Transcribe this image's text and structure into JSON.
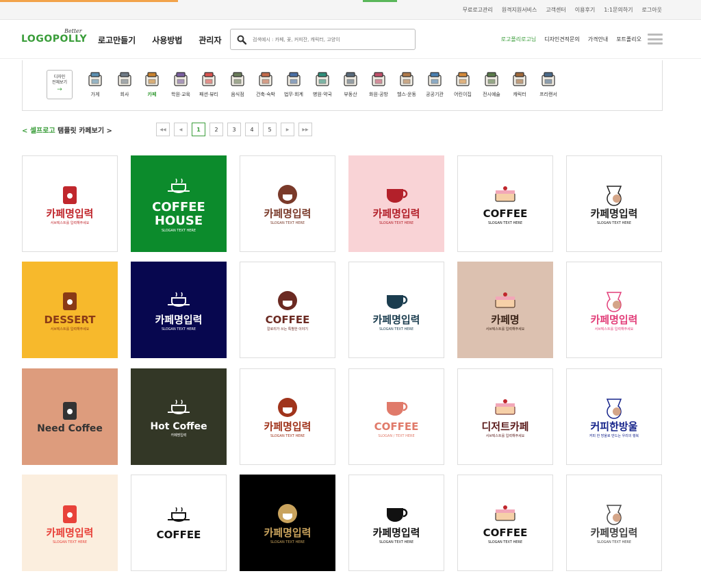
{
  "util_links": [
    "무료로고관리",
    "원격지원서비스",
    "고객센터",
    "이용후기",
    "1:1문의하기",
    "로그아웃"
  ],
  "brand": {
    "better": "Better",
    "name": "LOGOPOLLY",
    "color": "#3a9d3a"
  },
  "main_nav": [
    "로고만들기",
    "사용방법",
    "관리자"
  ],
  "search": {
    "placeholder": "검색예시 : 카페, 꽃, 커피잔, 캐릭터, 고양이"
  },
  "right_nav": [
    "로고폴리로고님",
    "디자인견적문의",
    "가격안내",
    "포트폴리오"
  ],
  "category_all": {
    "line1": "디자인",
    "line2": "전체보기",
    "arrow": "→"
  },
  "categories": [
    "가게",
    "회사",
    "카페",
    "학원·교육",
    "패션·뷰티",
    "음식점",
    "건축·숙박",
    "법무·회계",
    "병원·약국",
    "부동산",
    "화원·공방",
    "헬스·운동",
    "공공기관",
    "어린이집",
    "전시예술",
    "캐릭터",
    "프리랜서"
  ],
  "category_icons": [
    "store-icon",
    "building-icon",
    "coffee-cup-icon",
    "book-icon",
    "tshirt-icon",
    "plate-icon",
    "hotel-icon",
    "document-icon",
    "hospital-icon",
    "truck-icon",
    "easel-icon",
    "muscle-icon",
    "government-icon",
    "child-icon",
    "gallery-icon",
    "teddy-bear-icon",
    "computer-icon"
  ],
  "active_category": "카페",
  "breadcrumb": {
    "prefix": "< 셀프로고",
    "suffix": " 탬플릿 카페보기 >"
  },
  "pagination": {
    "first": "◀◀",
    "prev": "◀",
    "pages": [
      "1",
      "2",
      "3",
      "4",
      "5"
    ],
    "current": "1",
    "next": "▶",
    "last": "▶▶"
  },
  "templates": [
    {
      "title": "카페명입력",
      "sub": "서브텍스트를 입력해주세요",
      "bg": "#ffffff",
      "fg": "#c0272d",
      "icon": "coffee-bag-icon"
    },
    {
      "title": "COFFEE HOUSE",
      "sub": "SLOGAN TEXT HERE",
      "bg": "#0c8b2c",
      "fg": "#ffffff",
      "icon": "cup-steam-icon"
    },
    {
      "title": "카페명입력",
      "sub": "SLOGAN TEXT HERE",
      "bg": "#ffffff",
      "fg": "#7a3a2a",
      "icon": "round-cup-icon"
    },
    {
      "title": "카페명입력",
      "sub": "SLOGAN TEXT HERE",
      "bg": "#f9d3d6",
      "fg": "#b3202a",
      "icon": "teacup-icon"
    },
    {
      "title": "COFFEE",
      "sub": "SLOGAN TEXT HERE",
      "bg": "#ffffff",
      "fg": "#111111",
      "icon": "cake-icon"
    },
    {
      "title": "카페명입력",
      "sub": "SLOGAN TEXT HERE",
      "bg": "#ffffff",
      "fg": "#222222",
      "icon": "dripper-icon"
    },
    {
      "title": "DESSERT",
      "sub": "서브텍스트를 입력해주세요",
      "bg": "#f7b92c",
      "fg": "#8a3a16",
      "icon": "girl-icon"
    },
    {
      "title": "카페명입력",
      "sub": "SLOGAN TEXT HERE",
      "bg": "#07074f",
      "fg": "#ffffff",
      "icon": "cup-saucer-icon"
    },
    {
      "title": "COFFEE",
      "sub": "칼로리가 쓰는 특별한 이야기",
      "bg": "#ffffff",
      "fg": "#6b2a22",
      "icon": "bean-icon"
    },
    {
      "title": "카페명입력",
      "sub": "SLOGAN TEXT HERE",
      "bg": "#ffffff",
      "fg": "#1b3d4f",
      "icon": "takeout-cup-icon"
    },
    {
      "title": "카페명",
      "sub": "서브텍스트를 입력해주세요",
      "bg": "#dcc1b0",
      "fg": "#3b2418",
      "icon": "badge-frame-icon"
    },
    {
      "title": "카페명입력",
      "sub": "서브텍스트를 입력해주세요",
      "bg": "#ffffff",
      "fg": "#e23e79",
      "icon": "donut-icon"
    },
    {
      "title": "Need Coffee",
      "sub": "",
      "bg": "#dd9c7d",
      "fg": "#333333",
      "icon": "mug-25-icon"
    },
    {
      "title": "Hot Coffee",
      "sub": "카페명입력",
      "bg": "#333726",
      "fg": "#ffffff",
      "icon": "oval-frame-icon"
    },
    {
      "title": "카페명입력",
      "sub": "SLOGAN TEXT HERE",
      "bg": "#ffffff",
      "fg": "#a0341c",
      "icon": "steam-cup-icon"
    },
    {
      "title": "COFFEE",
      "sub": "SLOGAN / TEXT HERE",
      "bg": "#ffffff",
      "fg": "#e07a6a",
      "icon": "circle-badge-icon"
    },
    {
      "title": "디저트카페",
      "sub": "서브텍스트를 입력해주세요",
      "bg": "#ffffff",
      "fg": "#5a1a1a",
      "icon": "grinder-icon"
    },
    {
      "title": "커피한방울",
      "sub": "커피 한 방울로 만드는 우리의 행복",
      "bg": "#ffffff",
      "fg": "#15238a",
      "icon": "book-cup-icon"
    },
    {
      "title": "카페명입력",
      "sub": "SLOGAN TEXT HERE",
      "bg": "#fbeede",
      "fg": "#e8423a",
      "icon": "kettle-icon"
    },
    {
      "title": "COFFEE",
      "sub": "",
      "bg": "#ffffff",
      "fg": "#111111",
      "icon": "cup-character-icon"
    },
    {
      "title": "카페명입력",
      "sub": "SLOGAN TEXT HERE",
      "bg": "#000000",
      "fg": "#c9a35d",
      "icon": "gold-cup-icon"
    },
    {
      "title": "카페명입력",
      "sub": "SLOGAN TEXT HERE",
      "bg": "#ffffff",
      "fg": "#111111",
      "icon": "monstera-icon"
    },
    {
      "title": "COFFEE",
      "sub": "SLOGAN TEXT HERE",
      "bg": "#ffffff",
      "fg": "#111111",
      "icon": "sunrise-cup-icon"
    },
    {
      "title": "카페명입력",
      "sub": "SLOGAN TEXT HERE",
      "bg": "#ffffff",
      "fg": "#444444",
      "icon": "pancake-icon"
    }
  ]
}
